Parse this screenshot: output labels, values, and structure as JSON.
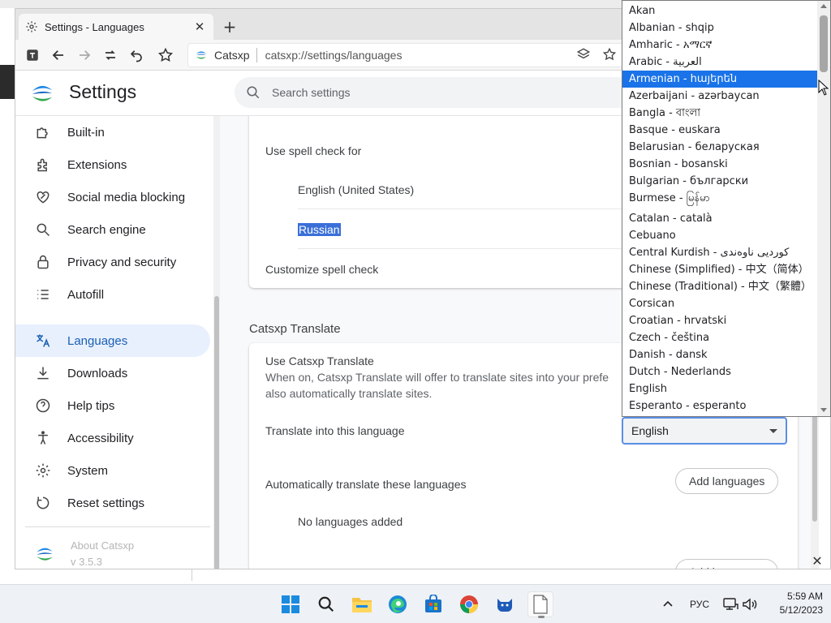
{
  "browser": {
    "tab_title": "Settings - Languages",
    "site_name": "Catsxp",
    "url": "catsxp://settings/languages"
  },
  "header": {
    "title": "Settings",
    "search_placeholder": "Search settings"
  },
  "sidebar": {
    "items": [
      {
        "label": "Built-in",
        "icon": "puzzle-icon"
      },
      {
        "label": "Extensions",
        "icon": "extensions-icon"
      },
      {
        "label": "Social media blocking",
        "icon": "heart-block-icon"
      },
      {
        "label": "Search engine",
        "icon": "search-icon"
      },
      {
        "label": "Privacy and security",
        "icon": "lock-icon"
      },
      {
        "label": "Autofill",
        "icon": "list-icon"
      },
      {
        "label": "Languages",
        "icon": "translate-icon",
        "active": true
      },
      {
        "label": "Downloads",
        "icon": "download-icon"
      },
      {
        "label": "Help tips",
        "icon": "help-icon"
      },
      {
        "label": "Accessibility",
        "icon": "accessibility-icon"
      },
      {
        "label": "System",
        "icon": "gear-icon"
      },
      {
        "label": "Reset settings",
        "icon": "reset-icon"
      }
    ],
    "about_line1": "About Catsxp",
    "about_line2": "v 3.5.3"
  },
  "spellcheck": {
    "use_for_label": "Use spell check for",
    "languages": [
      "English (United States)",
      "Russian"
    ],
    "customize_label": "Customize spell check"
  },
  "translate": {
    "section_title": "Catsxp Translate",
    "use_label": "Use Catsxp Translate",
    "description": "When on, Catsxp Translate will offer to translate sites into your prefe… also automatically translate sites.",
    "desc_line1": "When on, Catsxp Translate will offer to translate sites into your prefe",
    "desc_line2": "also automatically translate sites.",
    "into_label": "Translate into this language",
    "selected_language": "English",
    "auto_label": "Automatically translate these languages",
    "add_languages": "Add languages",
    "no_languages": "No languages added"
  },
  "dropdown": {
    "options": [
      "Akan",
      "Albanian - shqip",
      "Amharic - አማርኛ",
      "Arabic - العربية",
      "Armenian - հայերեն",
      "Azerbaijani - azərbaycan",
      "Bangla - বাংলা",
      "Basque - euskara",
      "Belarusian - беларуская",
      "Bosnian - bosanski",
      "Bulgarian - български",
      "Burmese - မြန်မာ",
      "Catalan - català",
      "Cebuano",
      "Central Kurdish - کوردیی ناوەندی",
      "Chinese (Simplified) - 中文（简体）",
      "Chinese (Traditional) - 中文（繁體）",
      "Corsican",
      "Croatian - hrvatski",
      "Czech - čeština",
      "Danish - dansk",
      "Dutch - Nederlands",
      "English",
      "Esperanto - esperanto"
    ],
    "highlighted": "Armenian - հայերեն"
  },
  "taskbar": {
    "apps": [
      "start-icon",
      "search-icon",
      "file-explorer-icon",
      "edge-icon",
      "store-icon",
      "chrome-icon",
      "catsxp-icon",
      "notepad-icon"
    ],
    "input_language": "РУС",
    "time": "5:59 AM",
    "date": "5/12/2023"
  },
  "colors": {
    "accent": "#1a73e8",
    "active_nav_bg": "#e8f0fe",
    "selection": "#3a6fd8",
    "logo_blue": "#1e88e5",
    "logo_green": "#34a853"
  }
}
